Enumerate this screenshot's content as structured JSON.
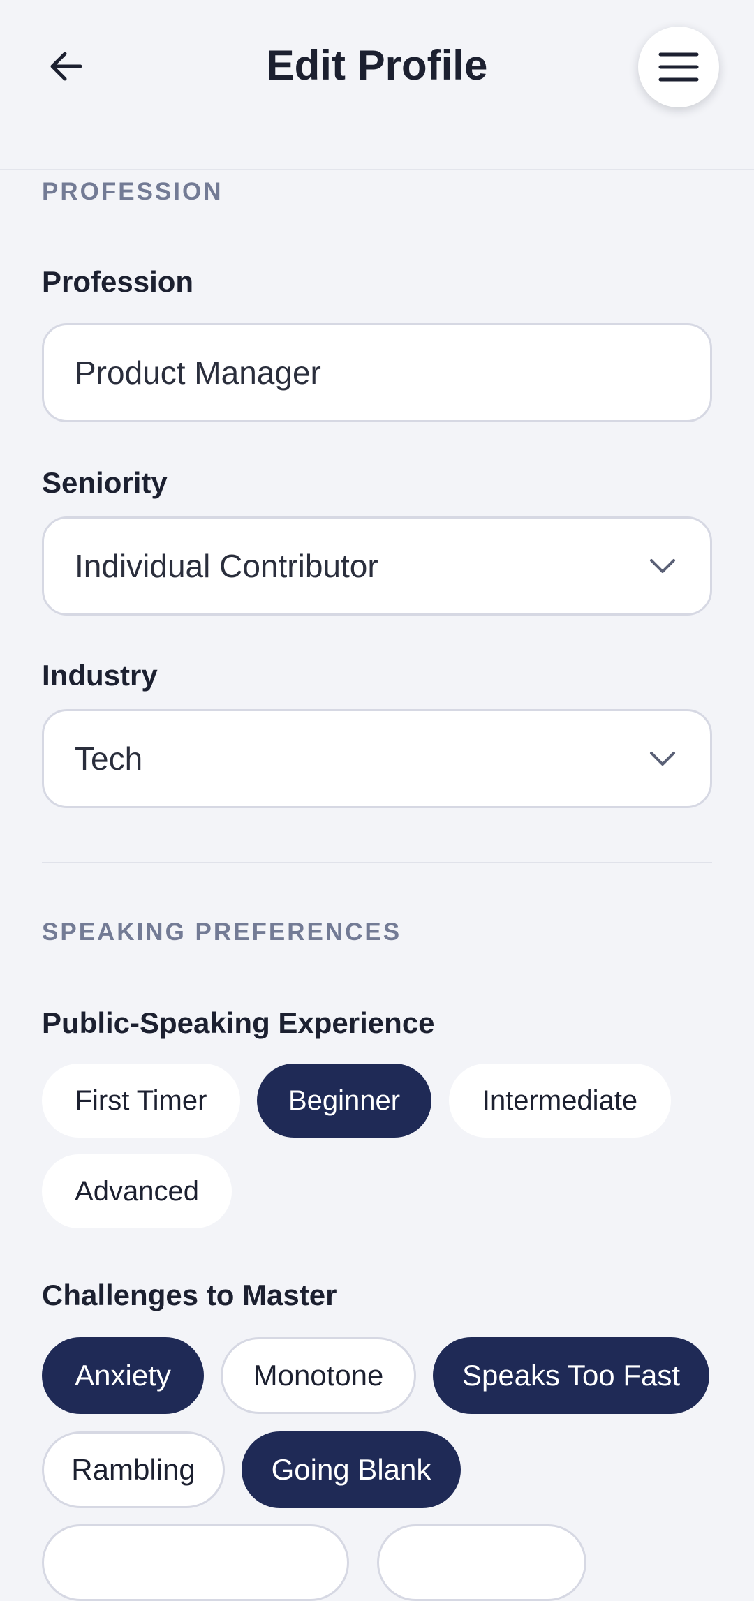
{
  "header": {
    "title": "Edit Profile",
    "back_icon": "arrow-left-icon",
    "menu_icon": "hamburger-menu-icon"
  },
  "profession_section": {
    "section_label": "PROFESSION",
    "profession": {
      "label": "Profession",
      "value": "Product Manager"
    },
    "seniority": {
      "label": "Seniority",
      "value": "Individual Contributor",
      "icon": "chevron-down-icon"
    },
    "industry": {
      "label": "Industry",
      "value": "Tech",
      "icon": "chevron-down-icon"
    }
  },
  "speaking_section": {
    "section_label": "SPEAKING PREFERENCES",
    "experience": {
      "label": "Public-Speaking Experience",
      "options": [
        {
          "label": "First Timer",
          "selected": false
        },
        {
          "label": "Beginner",
          "selected": true
        },
        {
          "label": "Intermediate",
          "selected": false
        },
        {
          "label": "Advanced",
          "selected": false
        }
      ]
    },
    "challenges": {
      "label": "Challenges to Master",
      "options": [
        {
          "label": "Anxiety",
          "selected": true
        },
        {
          "label": "Monotone",
          "selected": false
        },
        {
          "label": "Speaks Too Fast",
          "selected": true
        },
        {
          "label": "Rambling",
          "selected": false
        },
        {
          "label": "Going Blank",
          "selected": true
        }
      ]
    }
  },
  "colors": {
    "background": "#f3f4f8",
    "selected_chip": "#1f2a56",
    "section_label": "#737b95"
  }
}
